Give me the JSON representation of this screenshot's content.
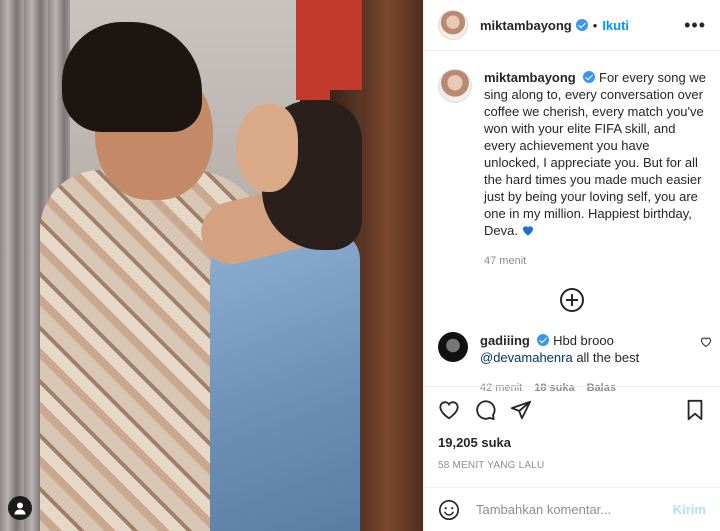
{
  "post": {
    "username": "miktambayong",
    "dot": "•",
    "follow_label": "Ikuti",
    "more_icon": "more-icon",
    "caption_text": "For every song we sing along to, every conversation over coffee we cherish, every match you've won with your elite FIFA skill, and every achievement you have unlocked, I appreciate you. But for all the hard times you made much easier just by being your loving self, you are one in my million. Happiest birthday, Deva.",
    "caption_time": "47 menit",
    "likes": "19,205 suka",
    "posted_ago": "58 MENIT YANG LALU"
  },
  "comment": {
    "username": "gadiiing",
    "text": "Hbd brooo",
    "mention": "@devamahenra",
    "text2": " all the best",
    "time": "42 menit",
    "likes": "18 suka",
    "reply": "Balas"
  },
  "composer": {
    "placeholder": "Tambahkan komentar...",
    "send_label": "Kirim"
  },
  "colors": {
    "accent": "#0095f6",
    "verified": "#3897f0",
    "muted": "#8e8e8e"
  }
}
